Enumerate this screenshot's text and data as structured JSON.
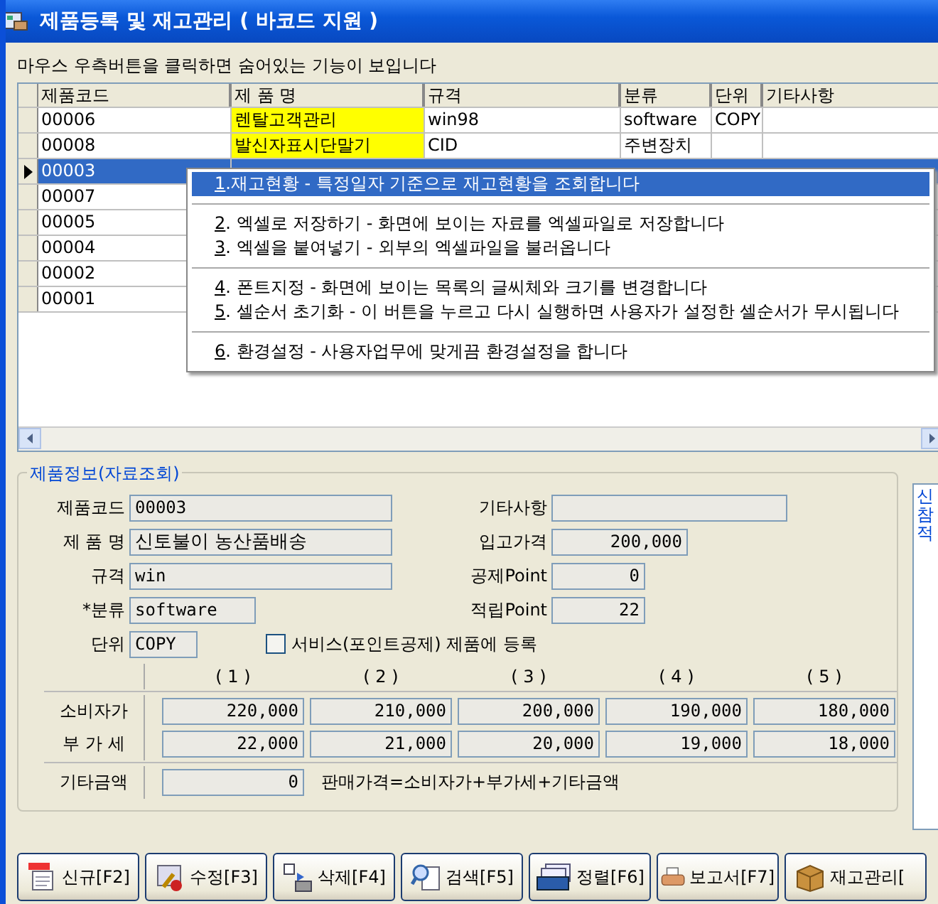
{
  "window": {
    "title": "제품등록 및 재고관리 ( 바코드 지원 )"
  },
  "hint": "마우스 우측버튼을 클릭하면 숨어있는 기능이 보입니다",
  "table": {
    "columns": [
      "제품코드",
      "제 품 명",
      "규격",
      "분류",
      "단위",
      "기타사항"
    ],
    "rows": [
      {
        "code": "00006",
        "name": "렌탈고객관리",
        "spec": "win98",
        "category": "software",
        "unit": "COPY",
        "highlighted": true,
        "selected": false
      },
      {
        "code": "00008",
        "name": "발신자표시단말기",
        "spec": "CID",
        "category": "주변장치",
        "highlighted": true,
        "selected": false
      },
      {
        "code": "00003",
        "selected": true
      },
      {
        "code": "00007",
        "selected": false
      },
      {
        "code": "00005",
        "selected": false
      },
      {
        "code": "00004",
        "selected": false
      },
      {
        "code": "00002",
        "selected": false
      },
      {
        "code": "00001",
        "selected": false
      }
    ]
  },
  "context_menu": {
    "groups": [
      [
        {
          "key": "1",
          "text": ".재고현황 - 특정일자 기준으로 재고현황을 조회합니다",
          "selected": true
        }
      ],
      [
        {
          "key": "2",
          "text": ". 엑셀로 저장하기 - 화면에 보이는 자료를 엑셀파일로 저장합니다",
          "selected": false
        },
        {
          "key": "3",
          "text": ". 엑셀을 붙여넣기 - 외부의 엑셀파일을 불러옵니다",
          "selected": false
        }
      ],
      [
        {
          "key": "4",
          "text": ". 폰트지정 - 화면에 보이는  목록의 글씨체와 크기를 변경합니다",
          "selected": false
        },
        {
          "key": "5",
          "text": ". 셀순서 초기화 - 이 버튼을 누르고 다시 실행하면 사용자가 설정한 셀순서가 무시됩니다",
          "selected": false
        }
      ],
      [
        {
          "key": "6",
          "text": ". 환경설정 - 사용자업무에 맞게끔 환경설정을 합니다",
          "selected": false
        }
      ]
    ]
  },
  "product_info": {
    "title": "제품정보(자료조회)",
    "code": {
      "label": "제품코드",
      "value": "00003"
    },
    "name": {
      "label": "제 품 명",
      "value": "신토불이 농산품배송"
    },
    "spec": {
      "label": "규격",
      "value": "win"
    },
    "category": {
      "label": "*분류",
      "value": "software"
    },
    "unit": {
      "label": "단위",
      "value": "COPY"
    },
    "notes": {
      "label": "기타사항"
    },
    "purchase_price": {
      "label": "입고가격",
      "value": "200,000"
    },
    "deduct_point": {
      "label": "공제Point",
      "value": "0"
    },
    "earn_point": {
      "label": "적립Point",
      "value": "22"
    },
    "service_checkbox": {
      "label": "서비스(포인트공제) 제품에 등록",
      "checked": false
    },
    "price_columns": [
      "( 1 )",
      "( 2 )",
      "( 3 )",
      "( 4 )",
      "( 5 )"
    ],
    "price_rows": [
      {
        "label": "소비자가",
        "values": [
          "220,000",
          "210,000",
          "200,000",
          "190,000",
          "180,000"
        ]
      },
      {
        "label": "부 가 세",
        "values": [
          "22,000",
          "21,000",
          "20,000",
          "19,000",
          "18,000"
        ]
      }
    ],
    "other_amount": {
      "label": "기타금액",
      "value": "0",
      "note": "판매가격=소비자가+부가세+기타금액"
    }
  },
  "side_panel": {
    "lines": [
      "신",
      "참",
      "적"
    ]
  },
  "buttons": [
    "신규[F2]",
    "수정[F3]",
    "삭제[F4]",
    "검색[F5]",
    "정렬[F6]",
    "보고서[F7]",
    "재고관리["
  ]
}
